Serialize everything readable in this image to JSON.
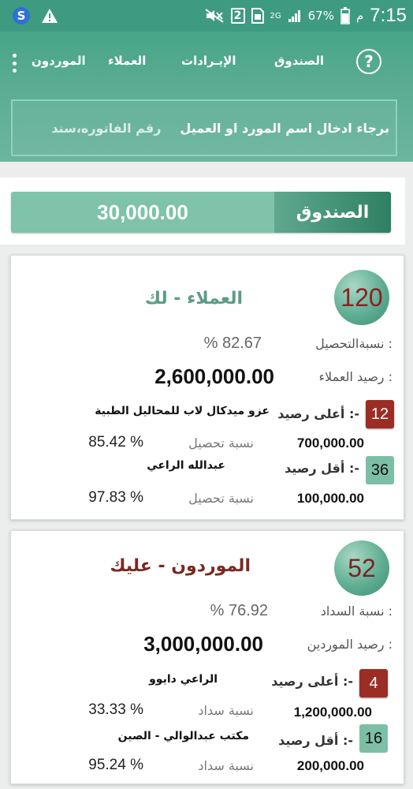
{
  "colors": {
    "primary": "#48a587",
    "status_bar": "#3e9b82",
    "clients_title": "#5b9c86",
    "suppliers_title": "#7a2a22",
    "count_text_clients": "#8b2020",
    "count_text_suppliers": "#7a2222",
    "badge_red": "#9c2d24",
    "badge_green": "#7dbfa6"
  },
  "status_bar": {
    "time": "7:15",
    "am_pm": "م",
    "battery": "67%",
    "network": "2G",
    "sim_slot": "2"
  },
  "nav": {
    "items": [
      "الصندوق",
      "الإيـرادات",
      "العملاء",
      "الموردون"
    ],
    "help_icon": "?"
  },
  "search": {
    "placeholder_main": "برجاء ادخال اسم المورد او العميل",
    "placeholder_extra": "رقم الفاتوره،سند"
  },
  "cash": {
    "label": "الصندوق",
    "value": "30,000.00"
  },
  "clients": {
    "count": "120",
    "title": "العملاء - لك",
    "collection_label": "نسبةالتحصيل :",
    "collection_value": "% 82.67",
    "balance_label": "رصيد العملاء :",
    "balance_value": "2,600,000.00",
    "highest": {
      "badge": "12",
      "label": "أعلى رصيد :-",
      "name": "عزو ميدكال لاب للمحاليل الطبية",
      "amount": "700,000.00",
      "ratio_label": "نسبة تحصيل",
      "ratio_value": "85.42  %"
    },
    "lowest": {
      "badge": "36",
      "label": "أقل رصيد :-",
      "name": "عبدالله الراعي",
      "amount": "100,000.00",
      "ratio_label": "نسبة تحصيل",
      "ratio_value": "97.83  %"
    }
  },
  "suppliers": {
    "count": "52",
    "title": "الموردون - عليك",
    "payment_label": "نسبة السداد :",
    "payment_value": "% 76.92",
    "balance_label": "رصيد الموردين :",
    "balance_value": "3,000,000.00",
    "highest": {
      "badge": "4",
      "label": "أعلى رصيد :-",
      "name": "الراعي دايوو",
      "amount": "1,200,000.00",
      "ratio_label": "نسبة سداد",
      "ratio_value": "33.33  %"
    },
    "lowest": {
      "badge": "16",
      "label": "أقل رصيد :-",
      "name": "مكتب عبدالوالي - الصين",
      "amount": "200,000.00",
      "ratio_label": "نسبة سداد",
      "ratio_value": "95.24  %"
    }
  }
}
